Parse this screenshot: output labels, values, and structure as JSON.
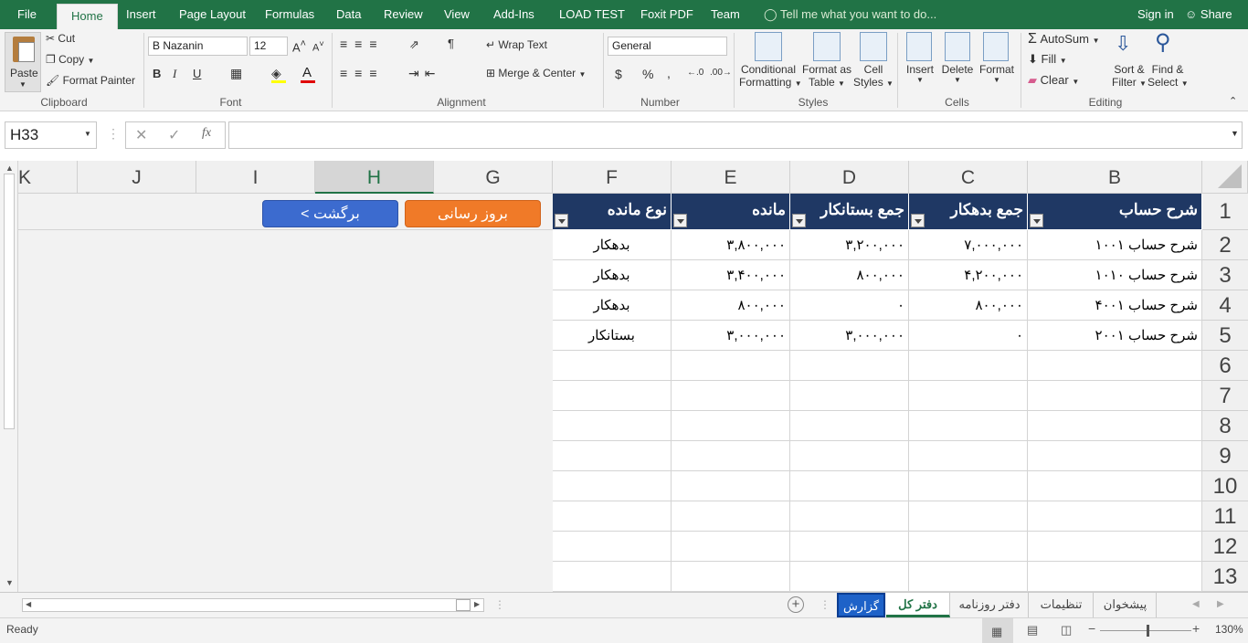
{
  "menu_tabs": [
    "File",
    "Home",
    "Insert",
    "Page Layout",
    "Formulas",
    "Data",
    "Review",
    "View",
    "Add-Ins",
    "LOAD TEST",
    "Foxit PDF",
    "Team"
  ],
  "tell_me": "Tell me what you want to do...",
  "signin": "Sign in",
  "share": "Share",
  "clipboard": {
    "paste": "Paste",
    "cut": "Cut",
    "copy": "Copy",
    "format_painter": "Format Painter",
    "label": "Clipboard"
  },
  "font": {
    "name": "B Nazanin",
    "size": "12",
    "bold": "B",
    "italic": "I",
    "underline": "U",
    "label": "Font"
  },
  "alignment": {
    "wrap": "Wrap Text",
    "merge": "Merge & Center",
    "label": "Alignment"
  },
  "number": {
    "format": "General",
    "currency": "$",
    "percent": "%",
    "comma": ",",
    "label": "Number"
  },
  "styles": {
    "cond1": "Conditional",
    "cond2": "Formatting",
    "fmt1": "Format as",
    "fmt2": "Table",
    "cell1": "Cell",
    "cell2": "Styles",
    "label": "Styles"
  },
  "cells": {
    "insert": "Insert",
    "delete": "Delete",
    "format": "Format",
    "label": "Cells"
  },
  "editing": {
    "autosum": "AutoSum",
    "fill": "Fill",
    "clear": "Clear",
    "sort1": "Sort &",
    "sort2": "Filter",
    "find1": "Find &",
    "find2": "Select",
    "label": "Editing"
  },
  "namebox": "H33",
  "columns": [
    "K",
    "J",
    "I",
    "H",
    "G",
    "F",
    "E",
    "D",
    "C",
    "B"
  ],
  "rows": [
    "1",
    "2",
    "3",
    "4",
    "5",
    "6",
    "7",
    "8",
    "9",
    "10",
    "11",
    "12",
    "13"
  ],
  "table": {
    "headers": [
      "شرح حساب",
      "جمع بدهکار",
      "جمع بستانکار",
      "مانده",
      "نوع مانده"
    ],
    "data": [
      [
        "شرح حساب ۱۰۰۱",
        "۷,۰۰۰,۰۰۰",
        "۳,۲۰۰,۰۰۰",
        "۳,۸۰۰,۰۰۰",
        "بدهکار"
      ],
      [
        "شرح حساب ۱۰۱۰",
        "۴,۲۰۰,۰۰۰",
        "۸۰۰,۰۰۰",
        "۳,۴۰۰,۰۰۰",
        "بدهکار"
      ],
      [
        "شرح حساب ۴۰۰۱",
        "۸۰۰,۰۰۰",
        "۰",
        "۸۰۰,۰۰۰",
        "بدهکار"
      ],
      [
        "شرح حساب ۲۰۰۱",
        "۰",
        "۳,۰۰۰,۰۰۰",
        "۳,۰۰۰,۰۰۰",
        "بستانکار"
      ]
    ]
  },
  "buttons": {
    "refresh": "بروز رسانی",
    "back": "برگشت >"
  },
  "sheet_tabs": [
    "گزارش",
    "دفتر کل",
    "دفتر روزنامه",
    "تنظیمات",
    "پیشخوان"
  ],
  "status": "Ready",
  "zoom": "130%",
  "colors": {
    "excel_green": "#217346",
    "header_navy": "#1f3864",
    "btn_orange": "#f07a28",
    "btn_blue": "#3c6bcf"
  }
}
